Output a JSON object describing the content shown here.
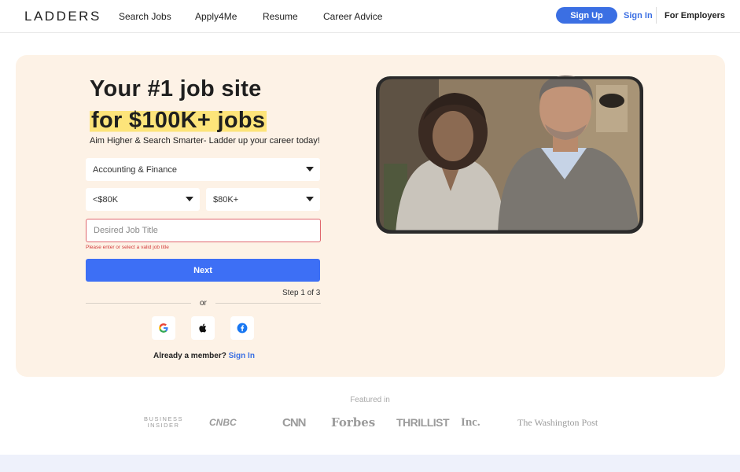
{
  "header": {
    "logo": "LADDERS",
    "nav": [
      "Search Jobs",
      "Apply4Me",
      "Resume",
      "Career Advice"
    ],
    "signup_label": "Sign Up",
    "signin_label": "Sign In",
    "employers_label": "For Employers"
  },
  "hero": {
    "title_line1": "Your #1 job site",
    "title_line2": "for $100K+ jobs",
    "subtitle": "Aim Higher & Search Smarter- Ladder up your career today!",
    "industry_selected": "Accounting & Finance",
    "salary_min_selected": "<$80K",
    "salary_max_selected": "$80K+",
    "job_title_placeholder": "Desired Job Title",
    "job_title_value": "",
    "error_message": "Please enter or select a valid job title",
    "next_label": "Next",
    "step_text": "Step 1 of 3",
    "or_text": "or",
    "already_member": "Already a member?",
    "already_signin": "Sign In"
  },
  "social": {
    "google_icon": "google-icon",
    "apple_icon": "apple-icon",
    "facebook_icon": "facebook-icon"
  },
  "featured": {
    "label": "Featured in",
    "press": [
      "BUSINESS INSIDER",
      "CNBC",
      "CNN",
      "Forbes",
      "THRILLIST",
      "Inc.",
      "The Washington Post"
    ]
  },
  "colors": {
    "accent": "#3b6fe3",
    "hero_bg": "#fdf2e6",
    "highlight": "#fde47a",
    "error": "#d23b3b"
  }
}
